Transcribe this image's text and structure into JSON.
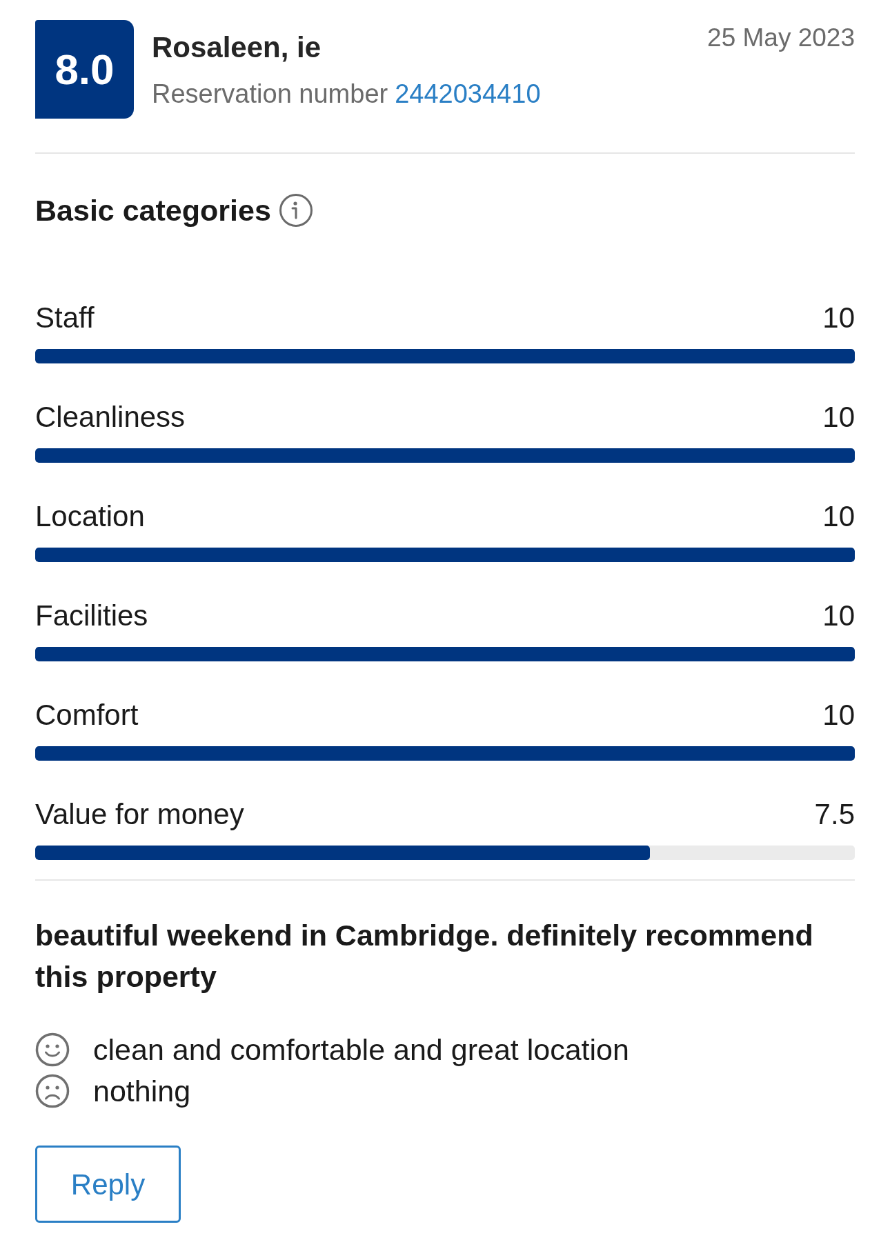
{
  "review": {
    "score": "8.0",
    "reviewer": "Rosaleen, ie",
    "reservation_label": "Reservation number",
    "reservation_number": "2442034410",
    "date": "25 May 2023"
  },
  "categories": {
    "title": "Basic categories",
    "items": [
      {
        "name": "Staff",
        "score": "10",
        "level": 1
      },
      {
        "name": "Cleanliness",
        "score": "10",
        "level": 1
      },
      {
        "name": "Location",
        "score": "10",
        "level": 1
      },
      {
        "name": "Facilities",
        "score": "10",
        "level": 1
      },
      {
        "name": "Comfort",
        "score": "10",
        "level": 1
      },
      {
        "name": "Value for money",
        "score": "7.5",
        "level": 0.75
      }
    ]
  },
  "comment": {
    "title": "beautiful weekend in Cambridge. definitely recommend this property",
    "points": [
      {
        "kind": "positive",
        "text": "clean and comfortable and great location"
      },
      {
        "kind": "negative",
        "text": "nothing"
      }
    ]
  },
  "reply_button": "Reply"
}
